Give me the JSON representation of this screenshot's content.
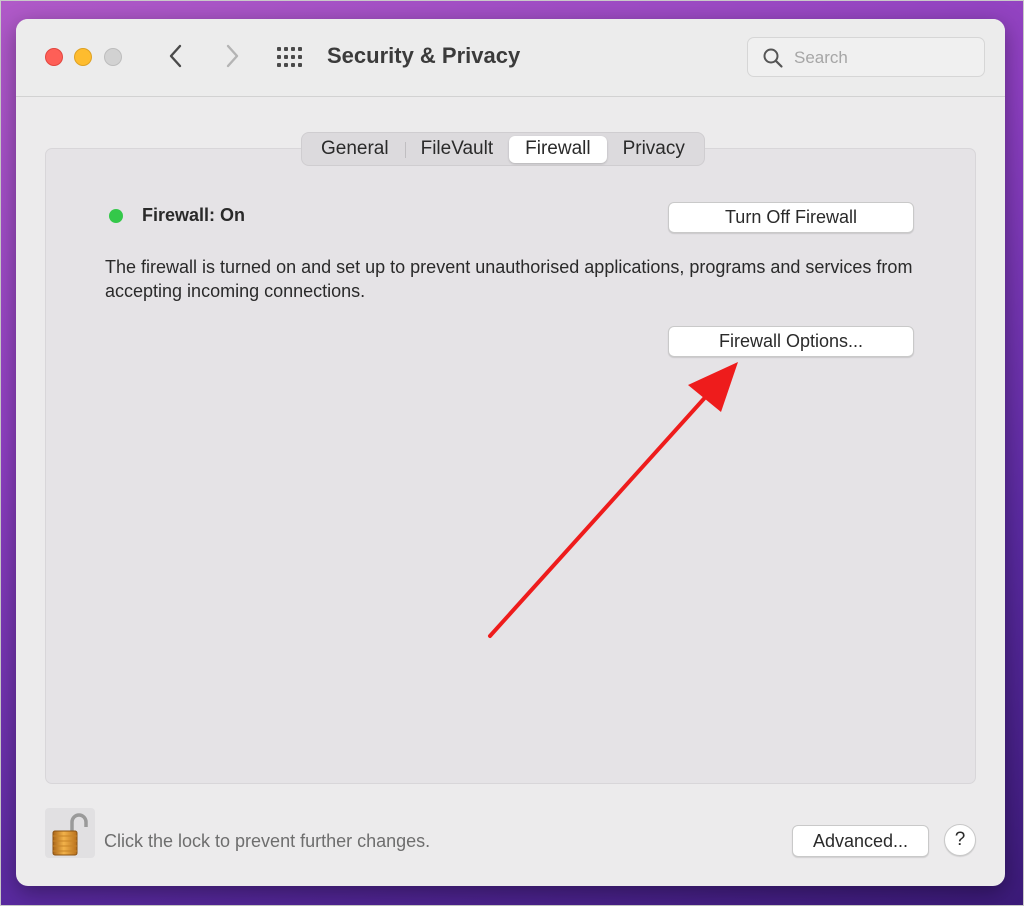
{
  "window": {
    "title": "Security & Privacy",
    "search": {
      "placeholder": "Search",
      "value": ""
    }
  },
  "tabs": [
    {
      "label": "General",
      "active": false
    },
    {
      "label": "FileVault",
      "active": false
    },
    {
      "label": "Firewall",
      "active": true
    },
    {
      "label": "Privacy",
      "active": false
    }
  ],
  "firewall": {
    "status": "Firewall: On",
    "status_color": "#34c84a",
    "turn_off_label": "Turn Off Firewall",
    "description": "The firewall is turned on and set up to prevent unauthorised applications, programs and services from accepting incoming connections.",
    "options_label": "Firewall Options..."
  },
  "footer": {
    "lock_text": "Click the lock to prevent further changes.",
    "advanced_label": "Advanced...",
    "help_label": "?"
  },
  "annotation": {
    "arrow_color": "#ee1c1c"
  },
  "icons": [
    "back-icon",
    "forward-icon",
    "grid-icon",
    "search-icon",
    "lock-icon"
  ]
}
